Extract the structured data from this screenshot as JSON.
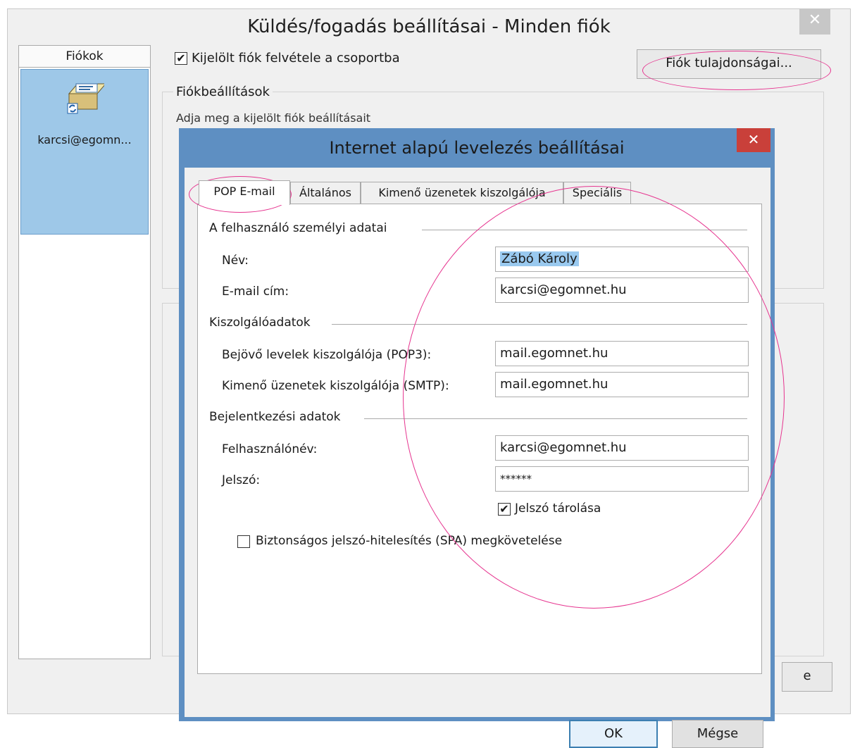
{
  "outer_window": {
    "title": "Küldés/fogadás beállításai - Minden fiók",
    "close_glyph": "✕",
    "accounts_header": "Fiókok",
    "account_name": "karcsi@egomn...",
    "include_checkbox_label": "Kijelölt fiók felvétele a csoportba",
    "include_checked": true,
    "account_properties_button": "Fiók tulajdonságai...",
    "settings_group_title": "Fiókbeállítások",
    "settings_description": "Adja meg a kijelölt fiók beállításait",
    "partial_close_button": "e"
  },
  "inner_dialog": {
    "title": "Internet alapú levelezés beállításai",
    "close_glyph": "✕",
    "tabs": [
      {
        "label": "POP E-mail",
        "active": true
      },
      {
        "label": "Általános",
        "active": false
      },
      {
        "label": "Kimenő üzenetek kiszolgálója",
        "active": false
      },
      {
        "label": "Speciális",
        "active": false
      }
    ],
    "user_section": {
      "title": "A felhasználó személyi adatai",
      "name_label": "Név:",
      "name_value": "Zábó Károly",
      "email_label": "E-mail cím:",
      "email_value": "karcsi@egomnet.hu"
    },
    "server_section": {
      "title": "Kiszolgálóadatok",
      "incoming_label": "Bejövő levelek kiszolgálója (POP3):",
      "incoming_value": "mail.egomnet.hu",
      "outgoing_label": "Kimenő üzenetek kiszolgálója (SMTP):",
      "outgoing_value": "mail.egomnet.hu"
    },
    "login_section": {
      "title": "Bejelentkezési adatok",
      "username_label": "Felhasználónév:",
      "username_value": "karcsi@egomnet.hu",
      "password_label": "Jelszó:",
      "password_value": "******",
      "remember_label": "Jelszó tárolása",
      "remember_checked": true,
      "spa_label": "Biztonságos jelszó-hitelesítés (SPA) megkövetelése",
      "spa_checked": false
    },
    "ok_button": "OK",
    "cancel_button": "Mégse"
  },
  "colors": {
    "selection_highlight": "#9ec8e8",
    "dialog_frame": "#5e8fc2",
    "close_red": "#c9403a",
    "annotation_pink": "#e6348f"
  }
}
